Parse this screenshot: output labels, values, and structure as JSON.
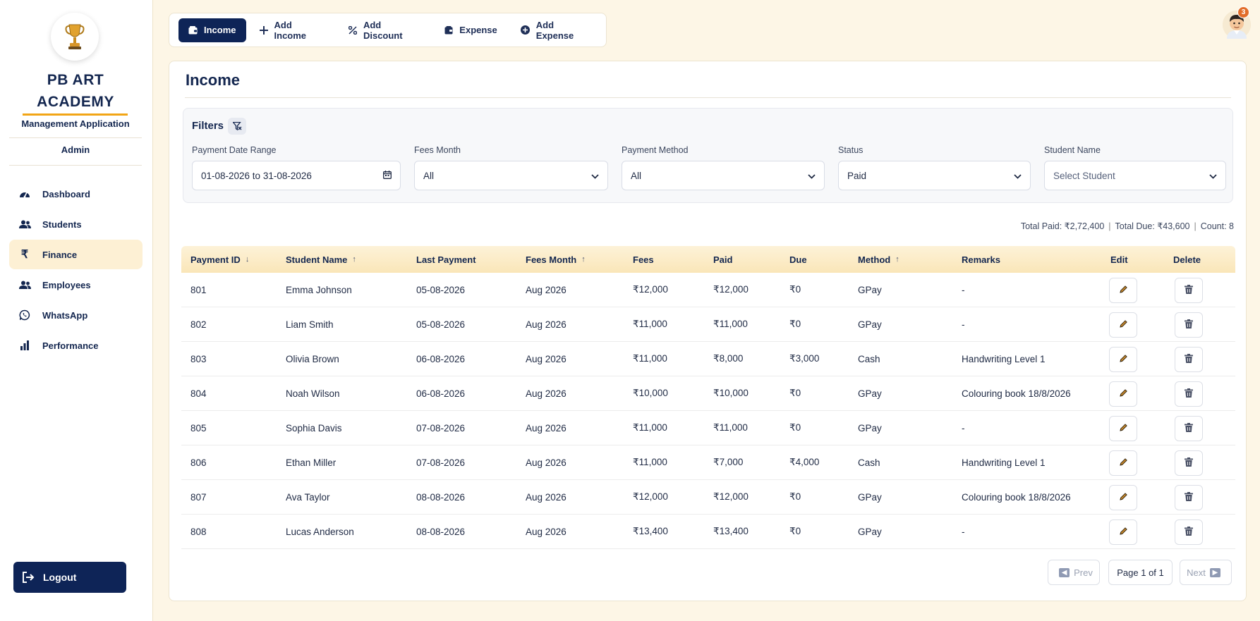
{
  "brand": {
    "name_line1": "PB ART",
    "name_line2": "ACADEMY",
    "subtitle": "Management Application",
    "role": "Admin",
    "logo_icon": "trophy-logo"
  },
  "sidebar": {
    "items": [
      {
        "label": "Dashboard",
        "icon": "dashboard-icon",
        "active": false
      },
      {
        "label": "Students",
        "icon": "students-icon",
        "active": false
      },
      {
        "label": "Finance",
        "icon": "rupee-icon",
        "active": true
      },
      {
        "label": "Employees",
        "icon": "employees-icon",
        "active": false
      },
      {
        "label": "WhatsApp",
        "icon": "whatsapp-icon",
        "active": false
      },
      {
        "label": "Performance",
        "icon": "bar-chart-icon",
        "active": false
      }
    ],
    "logout_label": "Logout"
  },
  "tabs": [
    {
      "label": "Income",
      "icon": "wallet-icon",
      "active": true
    },
    {
      "label": "Add Income",
      "icon": "plus-icon",
      "active": false
    },
    {
      "label": "Add Discount",
      "icon": "percent-icon",
      "active": false
    },
    {
      "label": "Expense",
      "icon": "expense-icon",
      "active": false
    },
    {
      "label": "Add Expense",
      "icon": "plus-circle-icon",
      "active": false
    }
  ],
  "header": {
    "notification_count": "3"
  },
  "page": {
    "title": "Income"
  },
  "filters": {
    "title": "Filters",
    "date_range_label": "Payment Date Range",
    "date_range_value": "01-08-2026 to 31-08-2026",
    "fees_month_label": "Fees Month",
    "fees_month_value": "All",
    "payment_method_label": "Payment Method",
    "payment_method_value": "All",
    "status_label": "Status",
    "status_value": "Paid",
    "student_name_label": "Student Name",
    "student_name_placeholder": "Select Student"
  },
  "totals": {
    "paid": "Total Paid: ₹2,72,400",
    "due": "Total Due: ₹43,600",
    "count": "Count: 8"
  },
  "table": {
    "columns": {
      "payment_id": "Payment ID",
      "student_name": "Student Name",
      "last_payment": "Last Payment",
      "fees_month": "Fees Month",
      "fees": "Fees",
      "paid": "Paid",
      "due": "Due",
      "method": "Method",
      "remarks": "Remarks",
      "edit": "Edit",
      "delete": "Delete"
    },
    "rows": [
      {
        "id": "801",
        "name": "Emma Johnson",
        "last": "05-08-2026",
        "month": "Aug 2026",
        "fees": "₹12,000",
        "paid": "₹12,000",
        "due": "₹0",
        "method": "GPay",
        "remarks": "-"
      },
      {
        "id": "802",
        "name": "Liam Smith",
        "last": "05-08-2026",
        "month": "Aug 2026",
        "fees": "₹11,000",
        "paid": "₹11,000",
        "due": "₹0",
        "method": "GPay",
        "remarks": "-"
      },
      {
        "id": "803",
        "name": "Olivia Brown",
        "last": "06-08-2026",
        "month": "Aug 2026",
        "fees": "₹11,000",
        "paid": "₹8,000",
        "due": "₹3,000",
        "method": "Cash",
        "remarks": "Handwriting Level 1"
      },
      {
        "id": "804",
        "name": "Noah Wilson",
        "last": "06-08-2026",
        "month": "Aug 2026",
        "fees": "₹10,000",
        "paid": "₹10,000",
        "due": "₹0",
        "method": "GPay",
        "remarks": "Colouring book 18/8/2026"
      },
      {
        "id": "805",
        "name": "Sophia Davis",
        "last": "07-08-2026",
        "month": "Aug 2026",
        "fees": "₹11,000",
        "paid": "₹11,000",
        "due": "₹0",
        "method": "GPay",
        "remarks": "-"
      },
      {
        "id": "806",
        "name": "Ethan Miller",
        "last": "07-08-2026",
        "month": "Aug 2026",
        "fees": "₹11,000",
        "paid": "₹7,000",
        "due": "₹4,000",
        "method": "Cash",
        "remarks": "Handwriting Level 1"
      },
      {
        "id": "807",
        "name": "Ava Taylor",
        "last": "08-08-2026",
        "month": "Aug 2026",
        "fees": "₹12,000",
        "paid": "₹12,000",
        "due": "₹0",
        "method": "GPay",
        "remarks": "Colouring book 18/8/2026"
      },
      {
        "id": "808",
        "name": "Lucas Anderson",
        "last": "08-08-2026",
        "month": "Aug 2026",
        "fees": "₹13,400",
        "paid": "₹13,400",
        "due": "₹0",
        "method": "GPay",
        "remarks": "-"
      }
    ]
  },
  "pagination": {
    "prev_label": "Prev",
    "page_label": "Page 1 of 1",
    "next_label": "Next"
  },
  "colors": {
    "primary": "#0e2457",
    "accent": "#f2a516",
    "background": "#fdf6e6"
  }
}
